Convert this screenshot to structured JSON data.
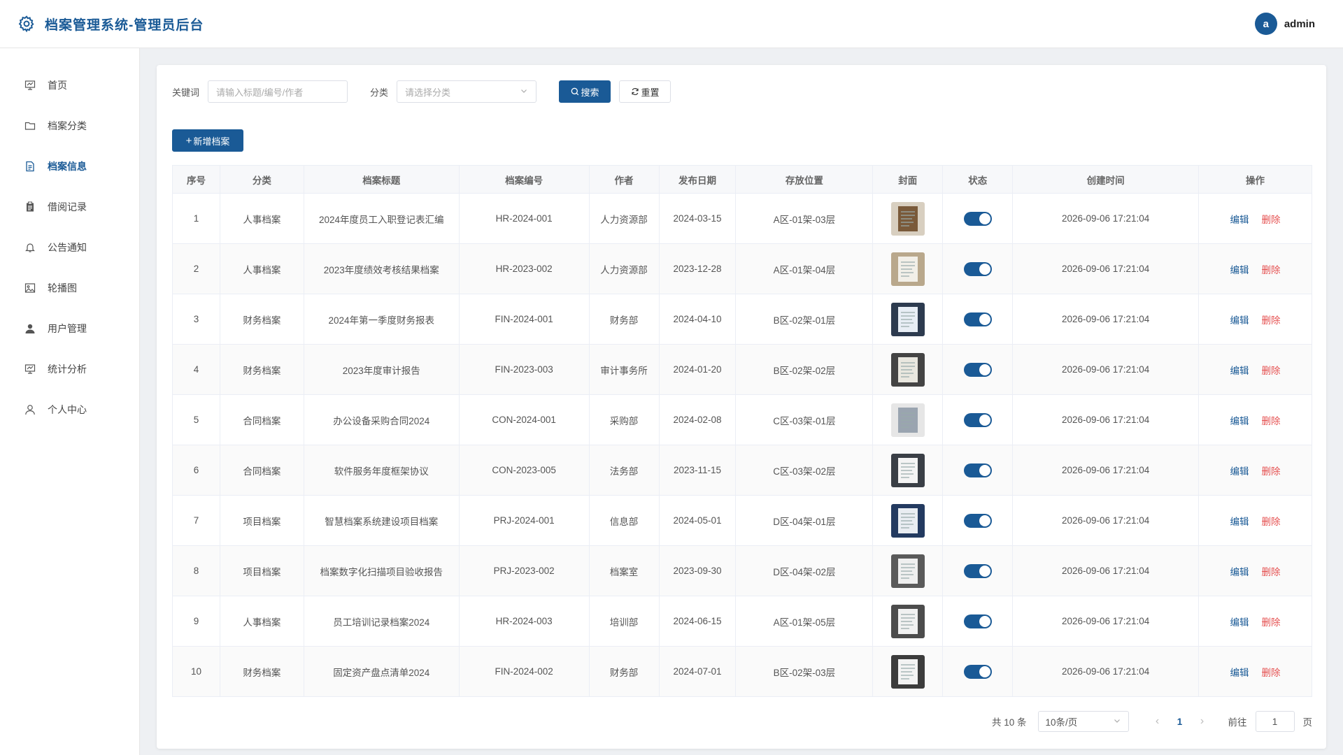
{
  "header": {
    "title": "档案管理系统-管理员后台",
    "avatar_letter": "a",
    "username": "admin"
  },
  "sidebar": {
    "items": [
      {
        "label": "首页",
        "icon": "presentation-icon"
      },
      {
        "label": "档案分类",
        "icon": "folder-icon"
      },
      {
        "label": "档案信息",
        "icon": "document-icon",
        "active": true
      },
      {
        "label": "借阅记录",
        "icon": "clipboard-icon"
      },
      {
        "label": "公告通知",
        "icon": "bell-icon"
      },
      {
        "label": "轮播图",
        "icon": "image-icon"
      },
      {
        "label": "用户管理",
        "icon": "user-filled-icon"
      },
      {
        "label": "统计分析",
        "icon": "chart-icon"
      },
      {
        "label": "个人中心",
        "icon": "user-outline-icon"
      }
    ]
  },
  "filter": {
    "keyword_label": "关键词",
    "keyword_placeholder": "请输入标题/编号/作者",
    "category_label": "分类",
    "category_placeholder": "请选择分类",
    "search_label": "搜索",
    "reset_label": "重置"
  },
  "add_label": "新增档案",
  "table": {
    "columns": [
      "序号",
      "分类",
      "档案标题",
      "档案编号",
      "作者",
      "发布日期",
      "存放位置",
      "封面",
      "状态",
      "创建时间",
      "操作"
    ],
    "edit_label": "编辑",
    "delete_label": "删除",
    "rows": [
      {
        "no": "1",
        "cat": "人事档案",
        "title": "2024年度员工入职登记表汇编",
        "code": "HR-2024-001",
        "author": "人力资源部",
        "date": "2024-03-15",
        "loc": "A区-01架-03层",
        "created": "2026-09-06 17:21:04",
        "status": true
      },
      {
        "no": "2",
        "cat": "人事档案",
        "title": "2023年度绩效考核结果档案",
        "code": "HR-2023-002",
        "author": "人力资源部",
        "date": "2023-12-28",
        "loc": "A区-01架-04层",
        "created": "2026-09-06 17:21:04",
        "status": true
      },
      {
        "no": "3",
        "cat": "财务档案",
        "title": "2024年第一季度财务报表",
        "code": "FIN-2024-001",
        "author": "财务部",
        "date": "2024-04-10",
        "loc": "B区-02架-01层",
        "created": "2026-09-06 17:21:04",
        "status": true
      },
      {
        "no": "4",
        "cat": "财务档案",
        "title": "2023年度审计报告",
        "code": "FIN-2023-003",
        "author": "审计事务所",
        "date": "2024-01-20",
        "loc": "B区-02架-02层",
        "created": "2026-09-06 17:21:04",
        "status": true
      },
      {
        "no": "5",
        "cat": "合同档案",
        "title": "办公设备采购合同2024",
        "code": "CON-2024-001",
        "author": "采购部",
        "date": "2024-02-08",
        "loc": "C区-03架-01层",
        "created": "2026-09-06 17:21:04",
        "status": true
      },
      {
        "no": "6",
        "cat": "合同档案",
        "title": "软件服务年度框架协议",
        "code": "CON-2023-005",
        "author": "法务部",
        "date": "2023-11-15",
        "loc": "C区-03架-02层",
        "created": "2026-09-06 17:21:04",
        "status": true
      },
      {
        "no": "7",
        "cat": "项目档案",
        "title": "智慧档案系统建设项目档案",
        "code": "PRJ-2024-001",
        "author": "信息部",
        "date": "2024-05-01",
        "loc": "D区-04架-01层",
        "created": "2026-09-06 17:21:04",
        "status": true
      },
      {
        "no": "8",
        "cat": "项目档案",
        "title": "档案数字化扫描项目验收报告",
        "code": "PRJ-2023-002",
        "author": "档案室",
        "date": "2023-09-30",
        "loc": "D区-04架-02层",
        "created": "2026-09-06 17:21:04",
        "status": true
      },
      {
        "no": "9",
        "cat": "人事档案",
        "title": "员工培训记录档案2024",
        "code": "HR-2024-003",
        "author": "培训部",
        "date": "2024-06-15",
        "loc": "A区-01架-05层",
        "created": "2026-09-06 17:21:04",
        "status": true
      },
      {
        "no": "10",
        "cat": "财务档案",
        "title": "固定资产盘点清单2024",
        "code": "FIN-2024-002",
        "author": "财务部",
        "date": "2024-07-01",
        "loc": "B区-02架-03层",
        "created": "2026-09-06 17:21:04",
        "status": true
      }
    ]
  },
  "pager": {
    "total_text": "共 10 条",
    "page_size": "10条/页",
    "current": "1",
    "goto_label": "前往",
    "goto_value": "1",
    "page_suffix": "页"
  },
  "colors": {
    "primary": "#1a5a96",
    "danger": "#e55050"
  }
}
